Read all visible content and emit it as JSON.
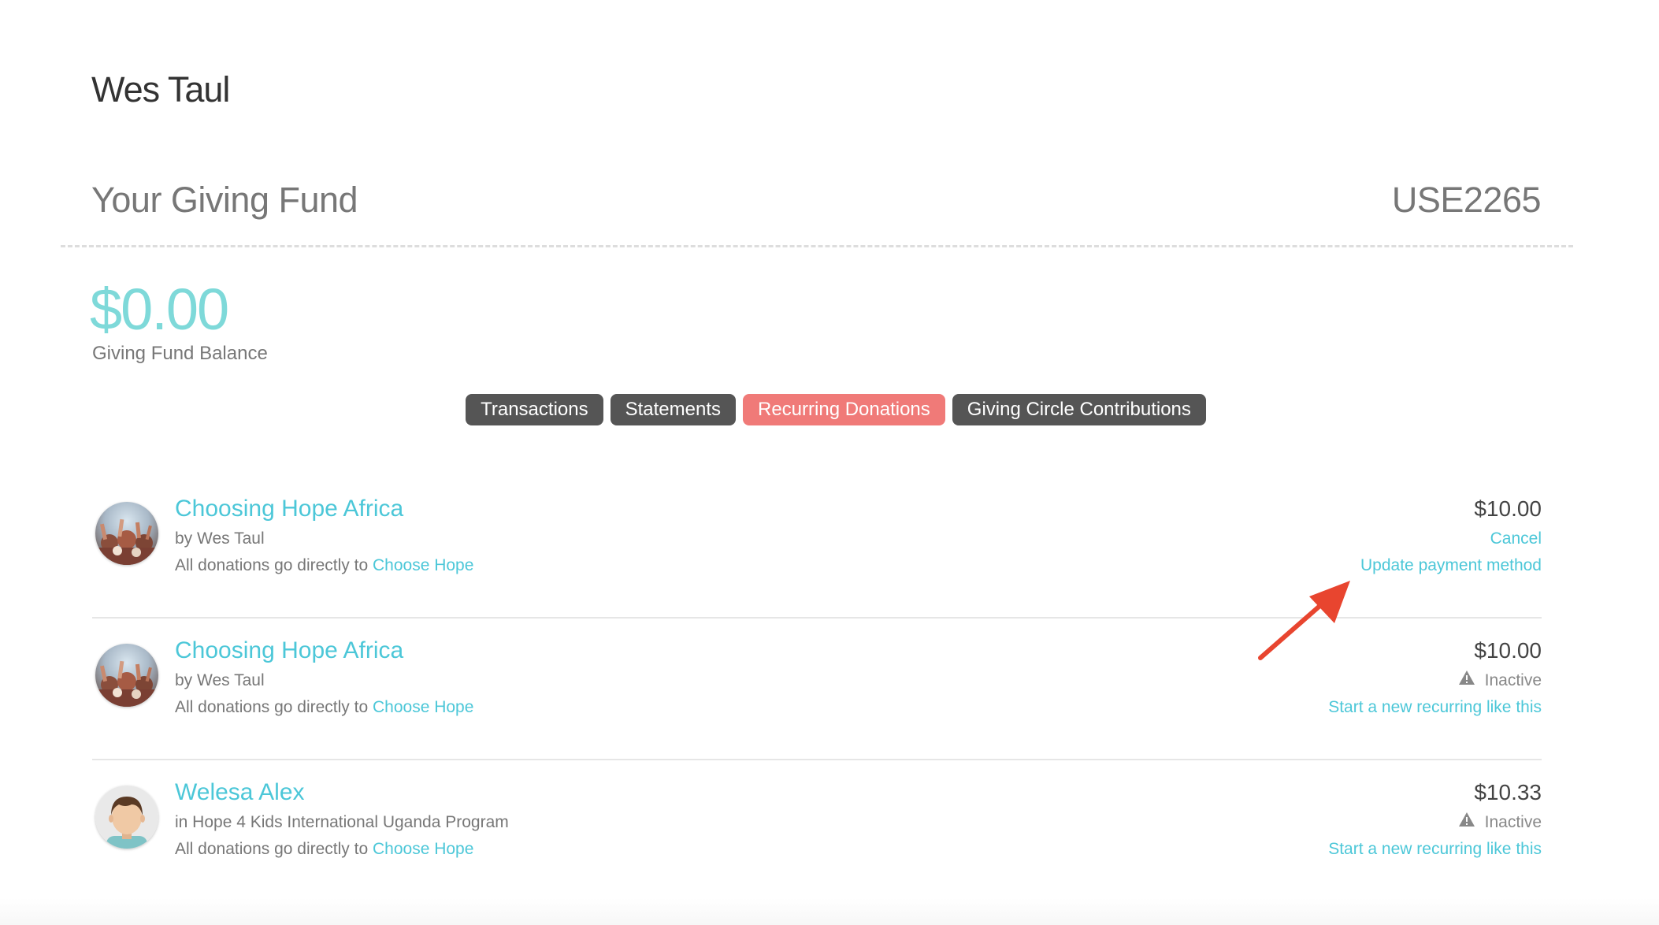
{
  "user": {
    "name": "Wes Taul"
  },
  "fund": {
    "title": "Your Giving Fund",
    "id": "USE2265",
    "balance": "$0.00",
    "balance_label": "Giving Fund Balance"
  },
  "tabs": [
    {
      "label": "Transactions",
      "active": false
    },
    {
      "label": "Statements",
      "active": false
    },
    {
      "label": "Recurring Donations",
      "active": true
    },
    {
      "label": "Giving Circle Contributions",
      "active": false
    }
  ],
  "donations": [
    {
      "title": "Choosing Hope Africa",
      "subtitle": "by Wes Taul",
      "note_prefix": "All donations go directly to",
      "note_link": "Choose Hope",
      "amount": "$10.00",
      "action_1": "Cancel",
      "action_2": "Update payment method",
      "avatar": "crowd-photo"
    },
    {
      "title": "Choosing Hope Africa",
      "subtitle": "by Wes Taul",
      "note_prefix": "All donations go directly to",
      "note_link": "Choose Hope",
      "amount": "$10.00",
      "status": "Inactive",
      "action": "Start a new recurring like this",
      "avatar": "crowd-photo"
    },
    {
      "title": "Welesa Alex",
      "subtitle": "in Hope 4 Kids International Uganda Program",
      "note_prefix": "All donations go directly to",
      "note_link": "Choose Hope",
      "amount": "$10.33",
      "status": "Inactive",
      "action": "Start a new recurring like this",
      "avatar": "boy-avatar"
    }
  ],
  "colors": {
    "accent": "#4cc7d8",
    "balance": "#7ed9d9",
    "active_tab": "#f07a78",
    "tab": "#555555",
    "annotation_arrow": "#e8452f"
  }
}
